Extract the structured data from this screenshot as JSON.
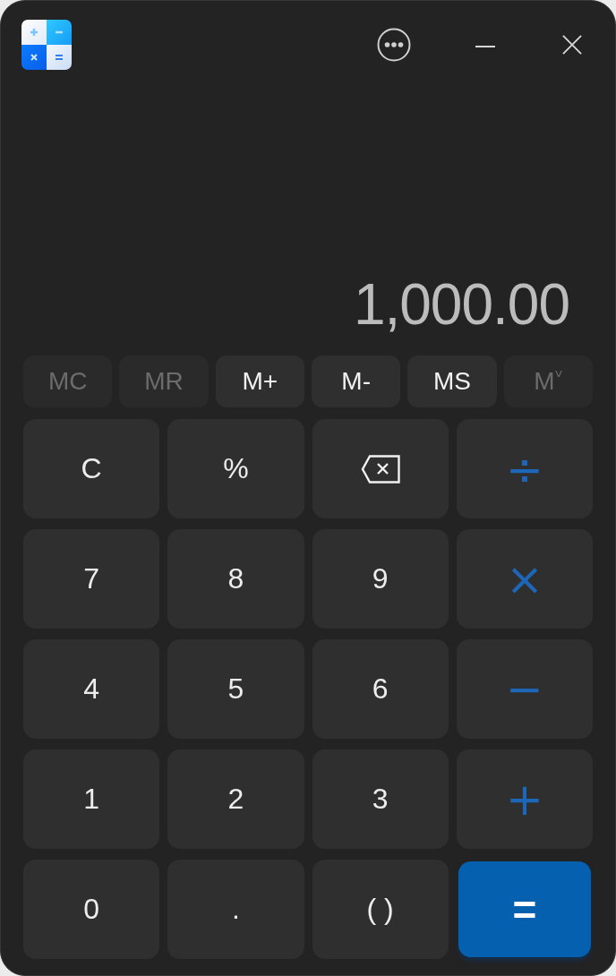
{
  "display": {
    "value": "1,000.00"
  },
  "memory": [
    {
      "label": "MC",
      "disabled": true
    },
    {
      "label": "MR",
      "disabled": true
    },
    {
      "label": "M+",
      "disabled": false
    },
    {
      "label": "M-",
      "disabled": false
    },
    {
      "label": "MS",
      "disabled": false
    },
    {
      "label": "M$^{˅}$",
      "disabled": true
    }
  ],
  "keys": [
    {
      "kind": "function",
      "label": "C"
    },
    {
      "kind": "function",
      "label": "%"
    },
    {
      "kind": "backspace"
    },
    {
      "kind": "operator",
      "label": "÷"
    },
    {
      "kind": "digit",
      "label": "7"
    },
    {
      "kind": "digit",
      "label": "8"
    },
    {
      "kind": "digit",
      "label": "9"
    },
    {
      "kind": "operator",
      "label": "×"
    },
    {
      "kind": "digit",
      "label": "4"
    },
    {
      "kind": "digit",
      "label": "5"
    },
    {
      "kind": "digit",
      "label": "6"
    },
    {
      "kind": "operator",
      "label": "−"
    },
    {
      "kind": "digit",
      "label": "1"
    },
    {
      "kind": "digit",
      "label": "2"
    },
    {
      "kind": "digit",
      "label": "3"
    },
    {
      "kind": "operator",
      "label": "+"
    },
    {
      "kind": "digit",
      "label": "0"
    },
    {
      "kind": "decimal",
      "label": "."
    },
    {
      "kind": "function",
      "label": "( )"
    },
    {
      "kind": "equals",
      "label": "="
    }
  ]
}
